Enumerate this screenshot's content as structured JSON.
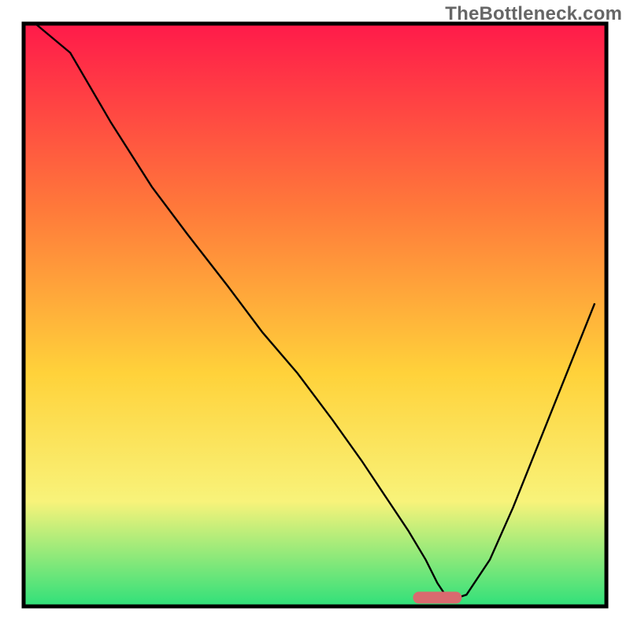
{
  "attribution": "TheBottleneck.com",
  "chart_data": {
    "type": "line",
    "title": "",
    "xlabel": "",
    "ylabel": "",
    "xlim": [
      0,
      100
    ],
    "ylim": [
      0,
      100
    ],
    "x": [
      2,
      8,
      15,
      22,
      28,
      35,
      41,
      47,
      53,
      58,
      62,
      66,
      69,
      71,
      73,
      76,
      80,
      84,
      88,
      92,
      96,
      98
    ],
    "values": [
      100,
      95,
      83,
      72,
      64,
      55,
      47,
      40,
      32,
      25,
      19,
      13,
      8,
      4,
      1,
      2,
      8,
      17,
      27,
      37,
      47,
      52
    ],
    "annotations": [
      {
        "kind": "pill",
        "x": 71,
        "y": 1.5,
        "color": "#d96a6f"
      }
    ],
    "background_gradient": {
      "top": "#ff1a4a",
      "upper_mid": "#ff7a3a",
      "mid": "#ffd23a",
      "lower": "#f8f37a",
      "bottom": "#2fe07a"
    }
  }
}
